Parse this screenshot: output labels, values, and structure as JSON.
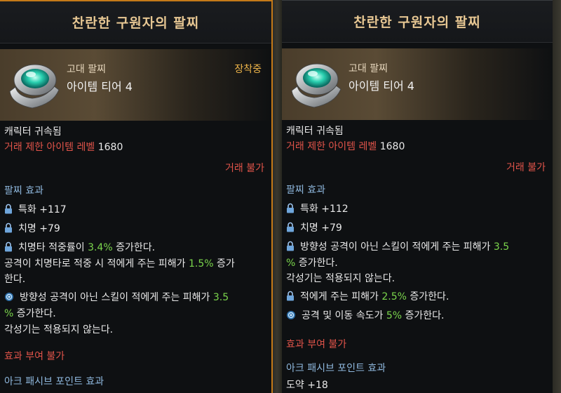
{
  "left": {
    "title": "찬란한 구원자의 팔찌",
    "item_type": "고대 팔찌",
    "item_tier": "아이템 티어 4",
    "equipped": "장착중",
    "bound": "캐릭터 귀속됨",
    "trade_label": "거래 제한 아이템 레벨",
    "trade_level": "1680",
    "tradeable": "거래 불가",
    "effects_title": "팔찌 효과",
    "stat1": "특화 +117",
    "stat2": "치명 +79",
    "eff1_a": "치명타 적중률이 ",
    "eff1_val": "3.4%",
    "eff1_b": " 증가한다.",
    "eff2_a": "공격이 치명타로 적중 시 적에게 주는 피해가 ",
    "eff2_val": "1.5%",
    "eff2_b": " 증가",
    "eff2_c": "한다.",
    "eff3_a": "방향성 공격이 아닌 스킬이 적에게 주는 피해가 ",
    "eff3_val": "3.5",
    "eff3_val2": "%",
    "eff3_b": " 증가한다.",
    "eff3_c": "각성기는 적용되지 않는다.",
    "no_grant": "효과 부여 불가",
    "ark_title": "아크 패시브 포인트 효과"
  },
  "right": {
    "title": "찬란한 구원자의 팔찌",
    "item_type": "고대 팔찌",
    "item_tier": "아이템 티어 4",
    "bound": "캐릭터 귀속됨",
    "trade_label": "거래 제한 아이템 레벨",
    "trade_level": "1680",
    "tradeable": "거래 불가",
    "effects_title": "팔찌 효과",
    "stat1": "특화 +112",
    "stat2": "치명 +79",
    "eff1_a": "방향성 공격이 아닌 스킬이 적에게 주는 피해가 ",
    "eff1_val": "3.5",
    "eff1_val2": "%",
    "eff1_b": " 증가한다.",
    "eff1_c": "각성기는 적용되지 않는다.",
    "eff2_a": "적에게 주는 피해가 ",
    "eff2_val": "2.5%",
    "eff2_b": " 증가한다.",
    "eff3_a": "공격 및 이동 속도가 ",
    "eff3_val": "5%",
    "eff3_b": " 증가한다.",
    "no_grant": "효과 부여 불가",
    "ark_title": "아크 패시브 포인트 효과",
    "ark_value": "도약 +18"
  },
  "colors": {
    "accent_border": "#c57a18",
    "title_gold": "#e7c793",
    "red": "#e2544a",
    "blue_label": "#8fb8de",
    "green_value": "#7bd64c",
    "equipped": "#f0b64a"
  },
  "icons": [
    "bracelet-icon",
    "lock-icon",
    "orb-icon"
  ]
}
